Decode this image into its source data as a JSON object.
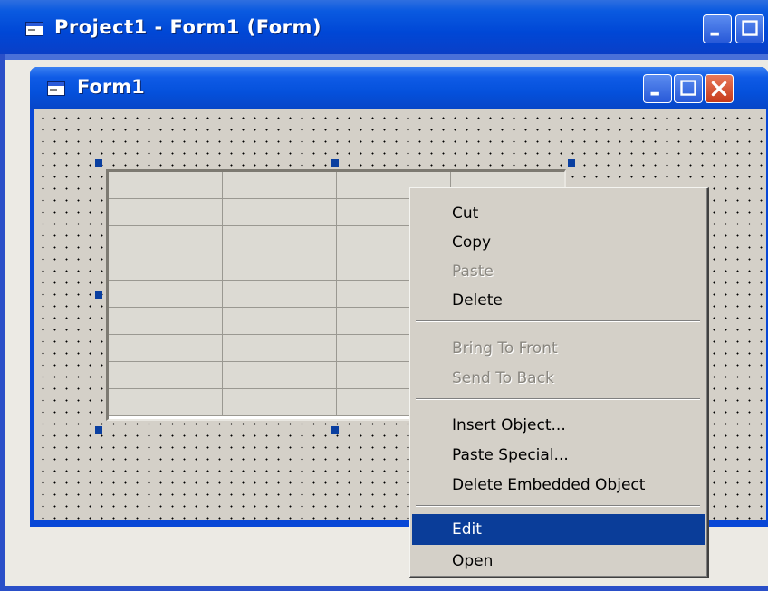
{
  "outer_window": {
    "title": "Project1 - Form1 (Form)",
    "icon": "form-icon"
  },
  "form_window": {
    "title": "Form1",
    "icon": "form-icon"
  },
  "grid": {
    "rows": 9,
    "columns": 4
  },
  "context_menu": {
    "items": [
      {
        "label": "Cut",
        "enabled": true
      },
      {
        "label": "Copy",
        "enabled": true
      },
      {
        "label": "Paste",
        "enabled": false
      },
      {
        "label": "Delete",
        "enabled": true
      },
      {
        "label": "Bring To Front",
        "enabled": false
      },
      {
        "label": "Send To Back",
        "enabled": false
      },
      {
        "label": "Insert Object...",
        "enabled": true
      },
      {
        "label": "Paste Special...",
        "enabled": true
      },
      {
        "label": "Delete Embedded Object",
        "enabled": true
      },
      {
        "label": "Edit",
        "enabled": true,
        "selected": true
      },
      {
        "label": "Open",
        "enabled": true
      }
    ]
  },
  "colors": {
    "title_bar": "#0a5ae0",
    "form_background": "#d4d0c8",
    "menu_highlight": "#0a3d99",
    "selection_handle": "#0a3fa0"
  }
}
